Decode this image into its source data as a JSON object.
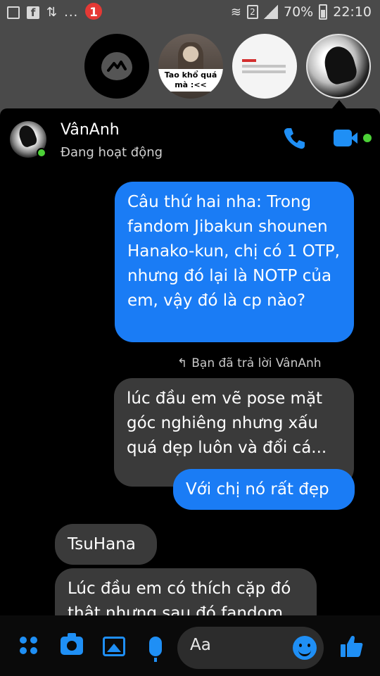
{
  "status_bar": {
    "left_dots": "...",
    "sim_number": "2",
    "battery_percent": "70%",
    "time": "22:10"
  },
  "chat_heads": {
    "badge_count": "1",
    "photo_caption_line1": "Tao khổ quá",
    "photo_caption_line2": "mà :<<"
  },
  "header": {
    "contact_name": "VânAnh",
    "status_text": "Đang hoạt động"
  },
  "messages": [
    {
      "direction": "outgoing",
      "text": "Câu thứ hai nha: Trong fandom Jibakun shounen Hanako-kun, chị có 1 OTP, nhưng đó lại là NOTP của em, vậy đó là cp nào?"
    },
    {
      "direction": "incoming",
      "text": "lúc đầu em vẽ pose mặt góc nghiêng nhưng xấu quá dẹp luôn và đổi cá..."
    },
    {
      "direction": "outgoing",
      "text": "Với chị nó rất đẹp"
    },
    {
      "direction": "incoming",
      "text": "TsuHana"
    },
    {
      "direction": "incoming",
      "text": "Lúc đầu em có thích cặp đó thật nhưng sau đó fandom"
    }
  ],
  "reply_note": "Bạn đã trả lời VânAnh",
  "composer": {
    "placeholder": "Aa"
  },
  "colors": {
    "accent": "#1f8ff5",
    "outgoing_bubble": "#1a7cf5",
    "incoming_bubble": "#3a3a3a",
    "online": "#4cd137",
    "badge": "#e53935"
  }
}
